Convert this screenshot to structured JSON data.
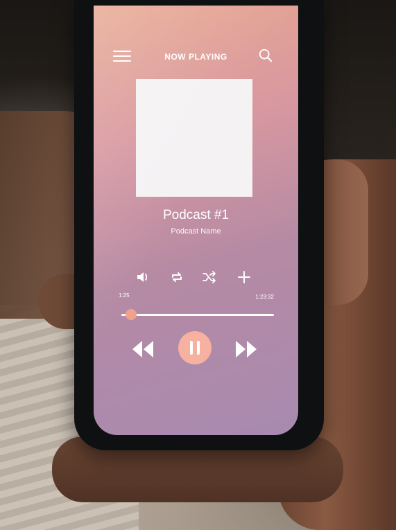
{
  "header": {
    "title": "NOW PLAYING"
  },
  "track": {
    "title": "Podcast #1",
    "subtitle": "Podcast Name"
  },
  "progress": {
    "elapsed": "1:25",
    "duration": "1:23:32",
    "fraction": 0.02
  },
  "icons": {
    "menu": "menu-icon",
    "search": "search-icon",
    "volume": "volume-icon",
    "repeat": "repeat-icon",
    "shuffle": "shuffle-icon",
    "add": "plus-icon",
    "rewind": "rewind-icon",
    "pause": "pause-icon",
    "fast_forward": "fast-forward-icon"
  },
  "colors": {
    "accent": "#f7b1a1",
    "text": "#ffffff",
    "artwork": "#f4f2f3"
  }
}
